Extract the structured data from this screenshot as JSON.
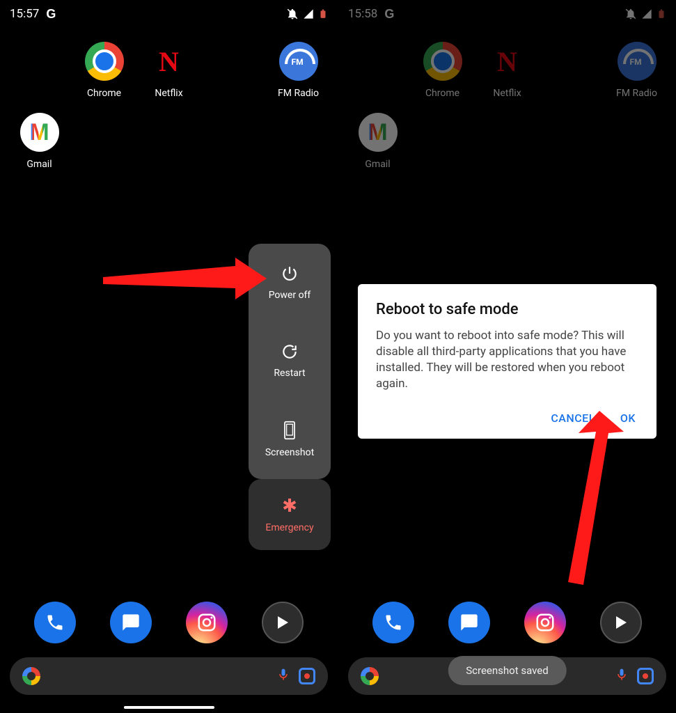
{
  "left": {
    "status": {
      "time": "15:57",
      "g": "G"
    },
    "apps": {
      "chrome": "Chrome",
      "netflix": "Netflix",
      "fmradio": "FM Radio",
      "gmail": "Gmail"
    },
    "power_menu": {
      "power_off": "Power off",
      "restart": "Restart",
      "screenshot": "Screenshot",
      "emergency": "Emergency"
    }
  },
  "right": {
    "status": {
      "time": "15:58",
      "g": "G"
    },
    "apps": {
      "chrome": "Chrome",
      "netflix": "Netflix",
      "fmradio": "FM Radio",
      "gmail": "Gmail"
    },
    "dialog": {
      "title": "Reboot to safe mode",
      "body": "Do you want to reboot into safe mode? This will disable all third-party applications that you have installed. They will be restored when you reboot again.",
      "cancel": "CANCEL",
      "ok": "OK"
    },
    "toast": "Screenshot saved"
  }
}
